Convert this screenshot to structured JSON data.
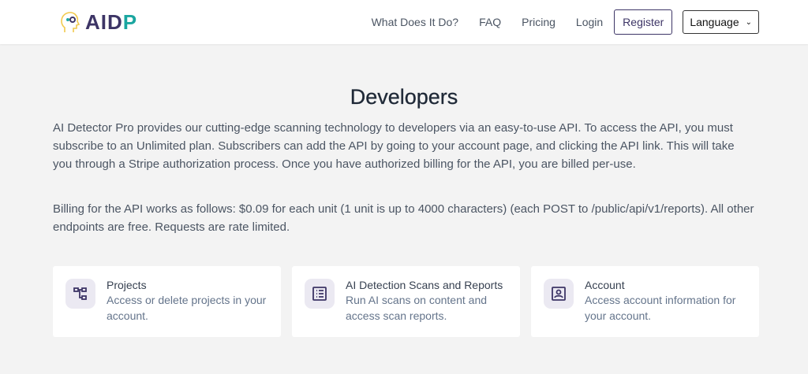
{
  "header": {
    "logo": "AIDP",
    "nav": [
      "What Does It Do?",
      "FAQ",
      "Pricing",
      "Login"
    ],
    "register": "Register",
    "language": "Language"
  },
  "main": {
    "title": "Developers",
    "intro": "AI Detector Pro provides our cutting-edge scanning technology to developers via an easy-to-use API. To access the API, you must subscribe to an Unlimited plan. Subscribers can add the API by going to your account page, and clicking the API link. This will take you through a Stripe authorization process. Once you have authorized billing for the API, you are billed per-use.",
    "billing": "Billing for the API works as follows: $0.09 for each unit (1 unit is up to 4000 characters) (each POST to /public/api/v1/reports). All other endpoints are free. Requests are rate limited.",
    "cards": [
      {
        "icon": "hierarchy-icon",
        "title": "Projects",
        "desc": "Access or delete projects in your account."
      },
      {
        "icon": "list-icon",
        "title": "AI Detection Scans and Reports",
        "desc": "Run AI scans on content and access scan reports."
      },
      {
        "icon": "account-icon",
        "title": "Account",
        "desc": "Access account information for your account."
      }
    ]
  }
}
